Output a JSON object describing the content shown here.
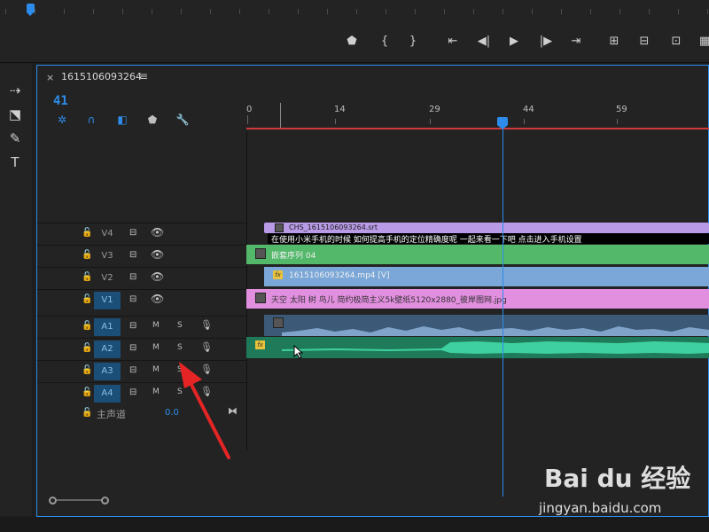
{
  "sequence_tab": {
    "close": "×",
    "title": "1615106093264",
    "menu": "≡"
  },
  "timecode": "41",
  "ruler_labels": [
    "0",
    "14",
    "29",
    "44",
    "59"
  ],
  "timeline_tools": [
    {
      "icon": "snap-icon",
      "glyph": "✲",
      "color": "#2d8ceb"
    },
    {
      "icon": "linked-selection-icon",
      "glyph": "∩",
      "color": "#2d8ceb"
    },
    {
      "icon": "add-marker-icon",
      "glyph": "◧",
      "color": "#2d8ceb"
    },
    {
      "icon": "marker-icon",
      "glyph": "⬟",
      "color": "#bdbdbd"
    },
    {
      "icon": "wrench-icon",
      "glyph": "🔧",
      "color": "#bdbdbd"
    }
  ],
  "transport": [
    "⬟",
    "{",
    "}",
    "⇤",
    "◀|",
    "▶",
    "|▶",
    "⇥",
    "⊞",
    "⊟",
    "⊡",
    "▦"
  ],
  "left_tools": [
    "⇢",
    "⬔",
    "✎",
    "T"
  ],
  "video_tracks": [
    {
      "name": "V4",
      "active": false
    },
    {
      "name": "V3",
      "active": false
    },
    {
      "name": "V2",
      "active": false
    },
    {
      "name": "V1",
      "active": true
    }
  ],
  "audio_tracks": [
    {
      "name": "A1",
      "active": true,
      "m": "M",
      "s": "S"
    },
    {
      "name": "A2",
      "active": true,
      "m": "M",
      "s": "S"
    },
    {
      "name": "A3",
      "active": true,
      "m": "M",
      "s": "S"
    },
    {
      "name": "A4",
      "active": true,
      "m": "M",
      "s": "S"
    }
  ],
  "master": {
    "label": "主声道",
    "value": "0.0"
  },
  "clips": {
    "v4_title": "CHS_1615106093264.srt",
    "v4_subtitle": "在使用小米手机的时候 如何提高手机的定位精确度呢 一起来看一下吧 点击进入手机设置",
    "v3": "嵌套序列 04",
    "v2": "1615106093264.mp4 [V]",
    "v1": "天空 太阳 树 鸟儿 简约极简主义5k壁纸5120x2880_彼岸图网.jpg"
  },
  "colors": {
    "accent": "#2d8ceb",
    "v4_clip": "#b89ae6",
    "v3_clip": "#53b86a",
    "v2_clip": "#7aa7d8",
    "v1_clip": "#e28fe0",
    "a1_clip": "#3c5a78",
    "a2_clip": "#1f7a5a",
    "work_bar": "#d23b3b"
  },
  "watermark": {
    "logo": "Bai du 经验",
    "url": "jingyan.baidu.com"
  }
}
